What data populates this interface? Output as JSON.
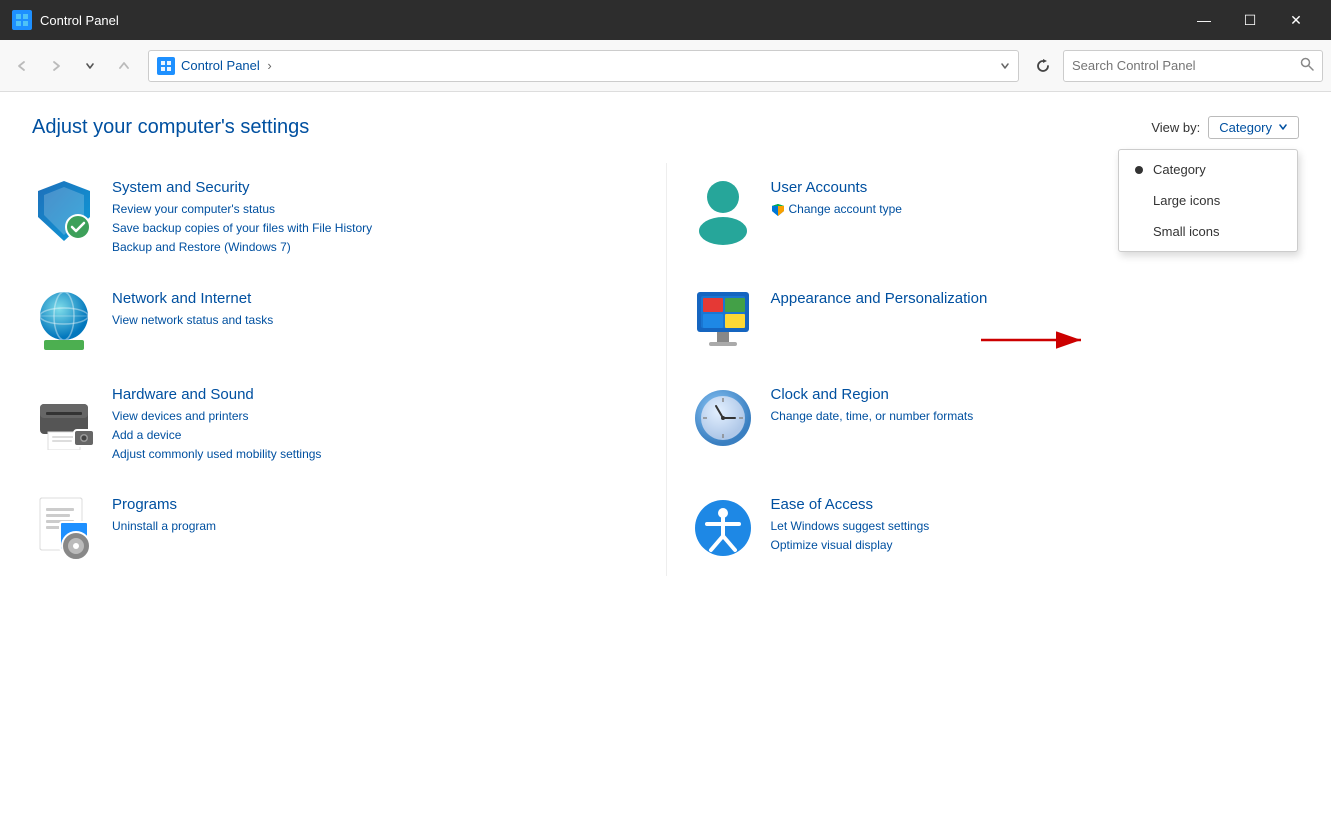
{
  "window": {
    "title": "Control Panel",
    "icon": "CP"
  },
  "titlebar": {
    "title": "Control Panel",
    "controls": {
      "minimize": "—",
      "maximize": "☐",
      "close": "✕"
    }
  },
  "toolbar": {
    "back_tooltip": "Back",
    "forward_tooltip": "Forward",
    "recent_tooltip": "Recent locations",
    "up_tooltip": "Up",
    "address": {
      "icon": "CP",
      "path": "Control Panel",
      "separator": "›"
    },
    "search_placeholder": "Search Control Panel"
  },
  "main": {
    "page_title": "Adjust your computer's settings",
    "viewby_label": "View by:",
    "viewby_current": "Category",
    "viewby_chevron": "▾",
    "dropdown": {
      "items": [
        {
          "label": "Category",
          "selected": true
        },
        {
          "label": "Large icons",
          "selected": false
        },
        {
          "label": "Small icons",
          "selected": false
        }
      ]
    },
    "categories": [
      {
        "id": "system-security",
        "title": "System and Security",
        "links": [
          "Review your computer's status",
          "Save backup copies of your files with File History",
          "Backup and Restore (Windows 7)"
        ]
      },
      {
        "id": "user-accounts",
        "title": "User Accounts",
        "links": [
          "Change account type"
        ]
      },
      {
        "id": "network-internet",
        "title": "Network and Internet",
        "links": [
          "View network status and tasks"
        ]
      },
      {
        "id": "appearance",
        "title": "Appearance and Personalization",
        "links": []
      },
      {
        "id": "hardware-sound",
        "title": "Hardware and Sound",
        "links": [
          "View devices and printers",
          "Add a device",
          "Adjust commonly used mobility settings"
        ]
      },
      {
        "id": "clock-region",
        "title": "Clock and Region",
        "links": [
          "Change date, time, or number formats"
        ]
      },
      {
        "id": "programs",
        "title": "Programs",
        "links": [
          "Uninstall a program"
        ]
      },
      {
        "id": "ease-access",
        "title": "Ease of Access",
        "links": [
          "Let Windows suggest settings",
          "Optimize visual display"
        ]
      }
    ]
  }
}
